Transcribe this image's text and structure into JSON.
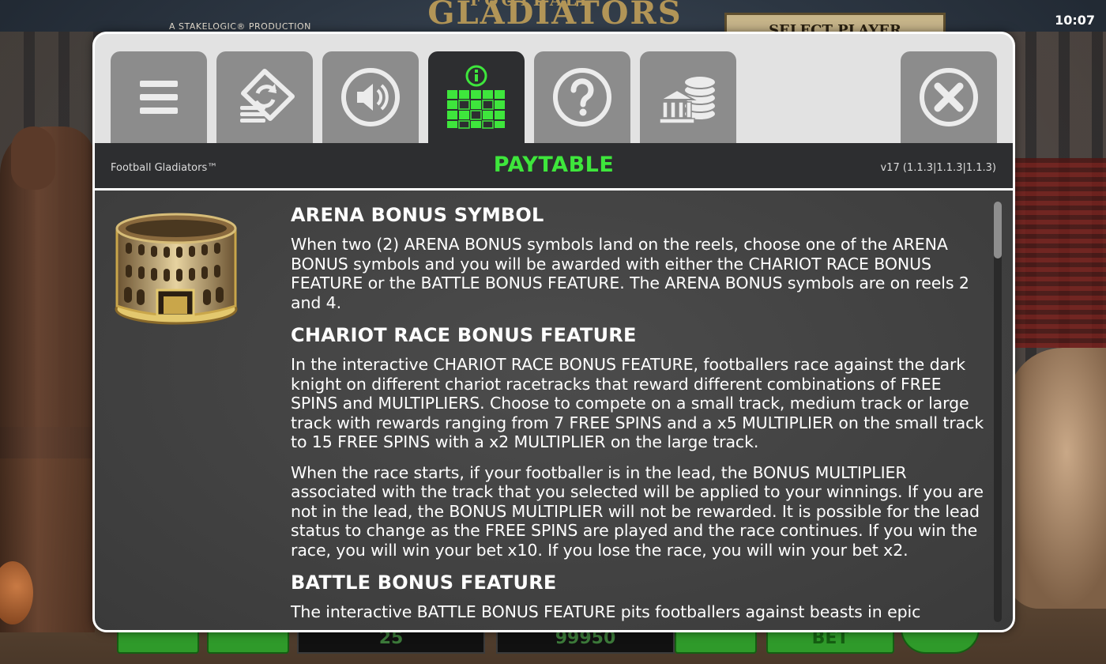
{
  "status": {
    "time": "10:07"
  },
  "background": {
    "production_label": "A STAKELOGIC® PRODUCTION",
    "logo_top": "FOOTBALL",
    "logo_main": "GLADIATORS",
    "select_player": "SELECT PLAYER",
    "bottom_values": [
      "25",
      "99950",
      "BET"
    ]
  },
  "tabs": [
    {
      "name": "menu",
      "icon": "hamburger-menu-icon",
      "active": false
    },
    {
      "name": "autoplay",
      "icon": "autoplay-cycle-icon",
      "active": false
    },
    {
      "name": "sound",
      "icon": "speaker-icon",
      "active": false
    },
    {
      "name": "paytable",
      "icon": "paytable-info-icon",
      "active": true
    },
    {
      "name": "help",
      "icon": "question-icon",
      "active": false
    },
    {
      "name": "bank",
      "icon": "coins-bank-icon",
      "active": false
    }
  ],
  "close_icon": "close-x-icon",
  "header": {
    "game_name": "Football Gladiators™",
    "title": "PAYTABLE",
    "version": "v17 (1.1.3|1.1.3|1.1.3)"
  },
  "colors": {
    "accent_green": "#3ee63c",
    "tab_gray": "#8c8c8c",
    "tab_active": "#2d2e30"
  },
  "sections": {
    "arena": {
      "title": "ARENA BONUS SYMBOL",
      "body": "When two (2) ARENA BONUS symbols land on the reels, choose one of the ARENA BONUS symbols and you will be awarded with either the CHARIOT RACE BONUS FEATURE or the BATTLE BONUS FEATURE. The ARENA BONUS symbols are on reels 2 and 4."
    },
    "chariot": {
      "title": "CHARIOT RACE BONUS FEATURE",
      "body1": "In the interactive CHARIOT RACE BONUS FEATURE, footballers race against the dark knight on different chariot racetracks that reward different combinations of FREE SPINS and MULTIPLIERS. Choose to compete on a small track, medium track or large track with rewards ranging from 7 FREE SPINS and a x5 MULTIPLIER on the small track to 15 FREE SPINS with a x2 MULTIPLIER on the large track.",
      "body2": "When the race starts, if your footballer is in the lead, the BONUS MULTIPLIER associated with the track that you selected will be applied to your winnings. If you are not in the lead, the BONUS MULTIPLIER will not be rewarded. It is possible for the lead status to change as the FREE SPINS are played and the race continues. If you win the race, you will win your bet x10. If you lose the race, you will win your bet x2."
    },
    "battle": {
      "title": "BATTLE BONUS FEATURE",
      "body": "The interactive BATTLE BONUS FEATURE pits footballers against beasts in epic"
    }
  },
  "scroll_position": 0.0
}
